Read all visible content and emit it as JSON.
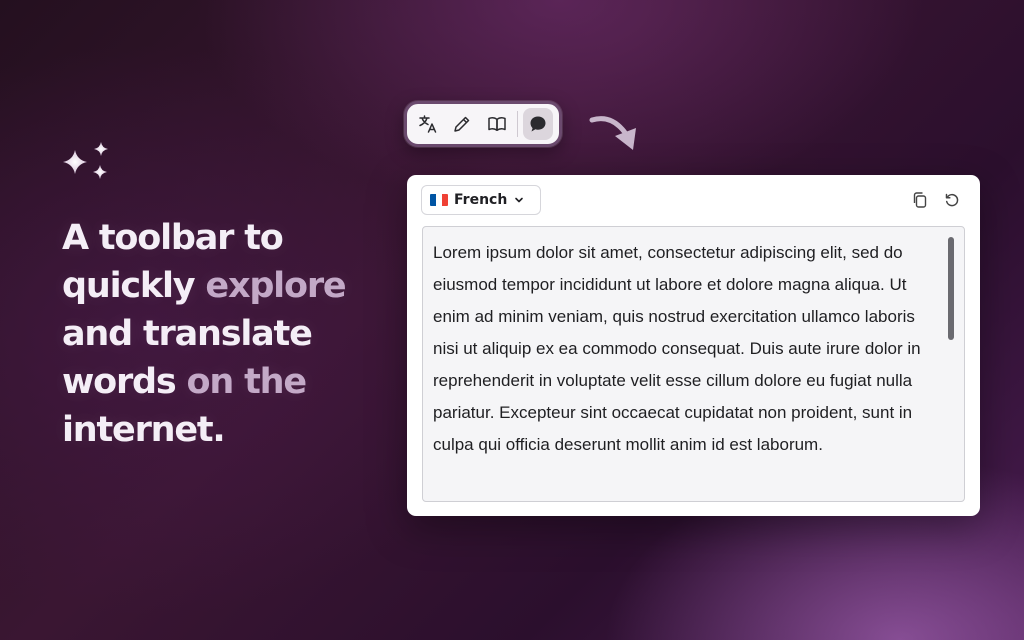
{
  "headline": {
    "line1_bright": "A toolbar to",
    "line2_bright": "quickly",
    "line2_dim": "explore",
    "line3_bright": "and translate",
    "line4_bright": "words",
    "line4_dim": "on the",
    "line5_bright": "internet."
  },
  "toolbar": {
    "buttons": [
      {
        "name": "translate",
        "icon": "translate-icon"
      },
      {
        "name": "edit",
        "icon": "pencil-icon"
      },
      {
        "name": "dictionary",
        "icon": "book-icon"
      },
      {
        "name": "chat",
        "icon": "speech-bubble-icon",
        "active": true
      }
    ]
  },
  "panel": {
    "language": "French",
    "language_flag": [
      "#0055a4",
      "#ffffff",
      "#ef4135"
    ],
    "text": "Lorem ipsum dolor sit amet, consectetur adipiscing elit, sed do eiusmod tempor incididunt ut labore et dolore magna aliqua. Ut enim ad minim veniam, quis nostrud exercitation ullamco laboris nisi ut aliquip ex ea commodo consequat. Duis aute irure dolor in reprehenderit in voluptate velit esse cillum dolore eu fugiat nulla pariatur. Excepteur sint occaecat cupidatat non proident, sunt in culpa qui officia deserunt mollit anim id est laborum."
  }
}
